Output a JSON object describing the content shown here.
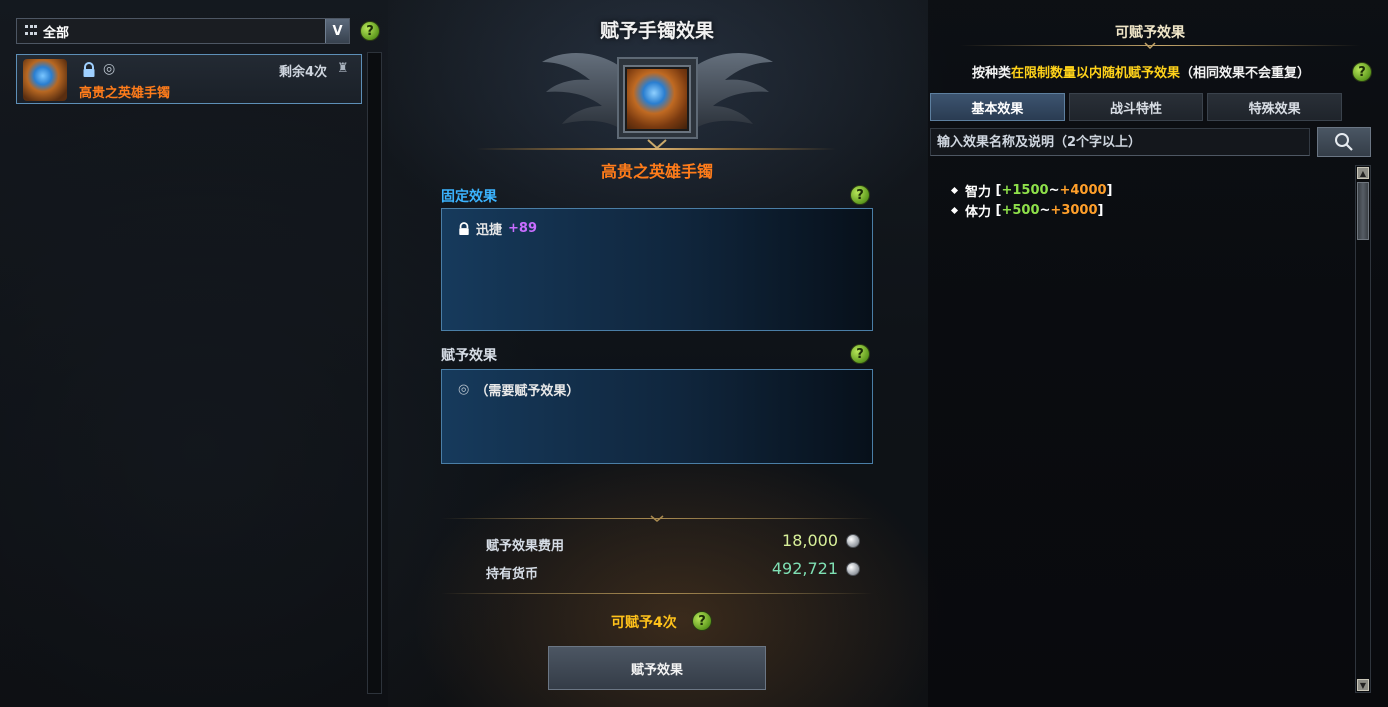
{
  "filter": {
    "label": "全部",
    "dropdown_glyph": "V"
  },
  "item_list": [
    {
      "name": "高贵之英雄手镯",
      "remaining": "剩余4次",
      "locked": true
    }
  ],
  "center": {
    "title": "赋予手镯效果",
    "item_name": "高贵之英雄手镯",
    "fixed_effect_label": "固定效果",
    "fixed_effect": {
      "stat": "迅捷",
      "value": "+89"
    },
    "grant_effect_label": "赋予效果",
    "grant_effect_placeholder": "（需要赋予效果）",
    "cost_label": "赋予效果费用",
    "cost_value": "18,000",
    "currency_label": "持有货币",
    "currency_value": "492,721",
    "can_grant_text": "可赋予4次",
    "grant_button_label": "赋予效果"
  },
  "right": {
    "title": "可赋予效果",
    "instructions_prefix": "按种类",
    "instructions_highlight": "在限制数量以内随机赋予效果",
    "instructions_suffix": "（相同效果不会重复）",
    "tabs": [
      {
        "label": "基本效果",
        "active": true
      },
      {
        "label": "战斗特性",
        "active": false
      },
      {
        "label": "特殊效果",
        "active": false
      }
    ],
    "search_placeholder": "输入效果名称及说明（2个字以上）",
    "effects": [
      {
        "stat": "智力",
        "min": "+1500",
        "max": "+4000"
      },
      {
        "stat": "体力",
        "min": "+500",
        "max": "+3000"
      }
    ]
  },
  "colors": {
    "item_name": "#ff7c1a",
    "fixed_label": "#3bb4ff",
    "stat_value": "#c86dff",
    "highlight": "#ffd21a",
    "cost_value": "#d8f09a",
    "currency_value": "#7fe0b4",
    "range_min": "#8ee04a",
    "range_max": "#ff9f2a"
  }
}
